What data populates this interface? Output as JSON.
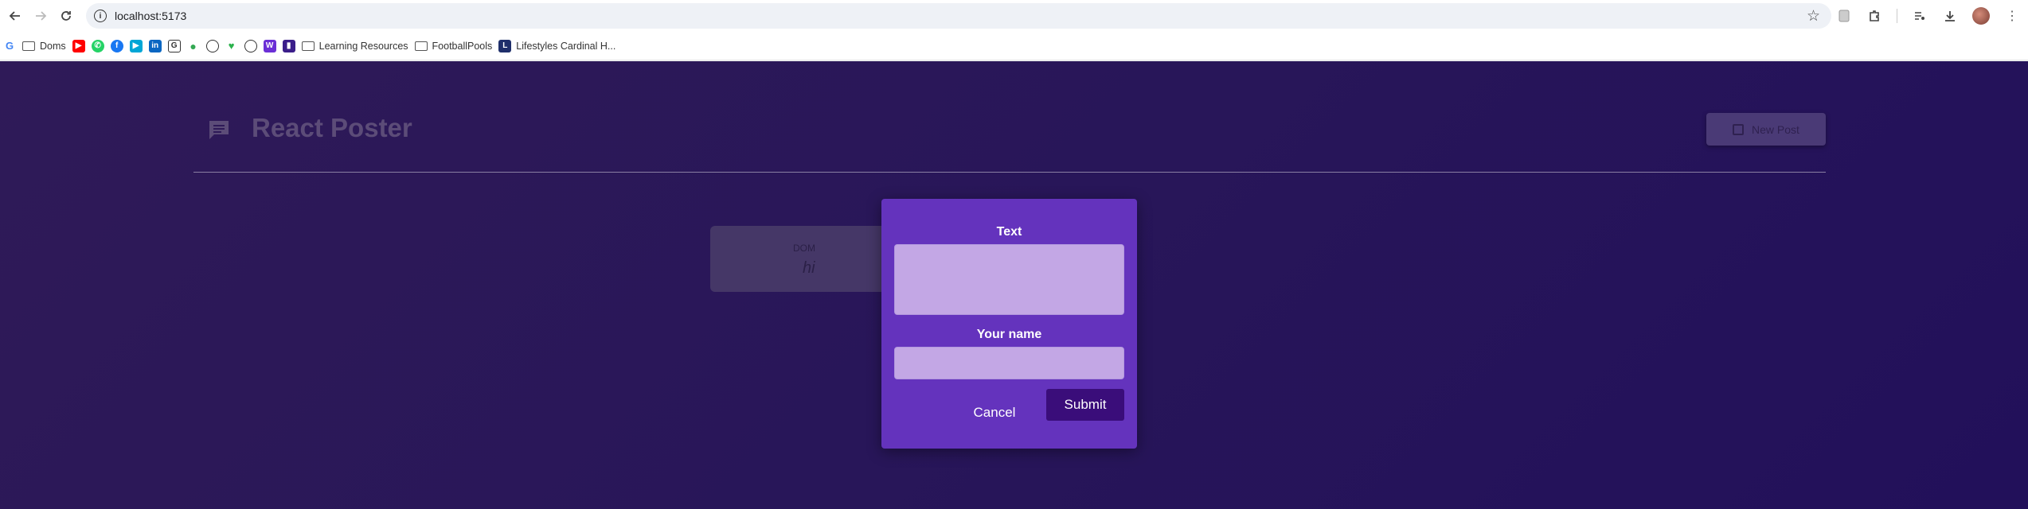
{
  "browser": {
    "url": "localhost:5173",
    "bookmarks": [
      {
        "label": "Doms",
        "type": "folder"
      },
      {
        "label": "Learning Resources",
        "type": "folder"
      },
      {
        "label": "FootballPools",
        "type": "folder"
      },
      {
        "label": "Lifestyles Cardinal H...",
        "type": "site"
      }
    ]
  },
  "app": {
    "title": "React Poster",
    "new_post_label": "New Post",
    "posts": [
      {
        "author": "DOM",
        "text": "hi"
      }
    ],
    "modal": {
      "text_label": "Text",
      "text_value": "",
      "name_label": "Your name",
      "name_value": "",
      "cancel_label": "Cancel",
      "submit_label": "Submit"
    }
  },
  "colors": {
    "page_bg": "#281659",
    "modal_bg": "#6433bd",
    "input_bg": "#c3a7e5",
    "submit_bg": "#3a0d7a"
  }
}
